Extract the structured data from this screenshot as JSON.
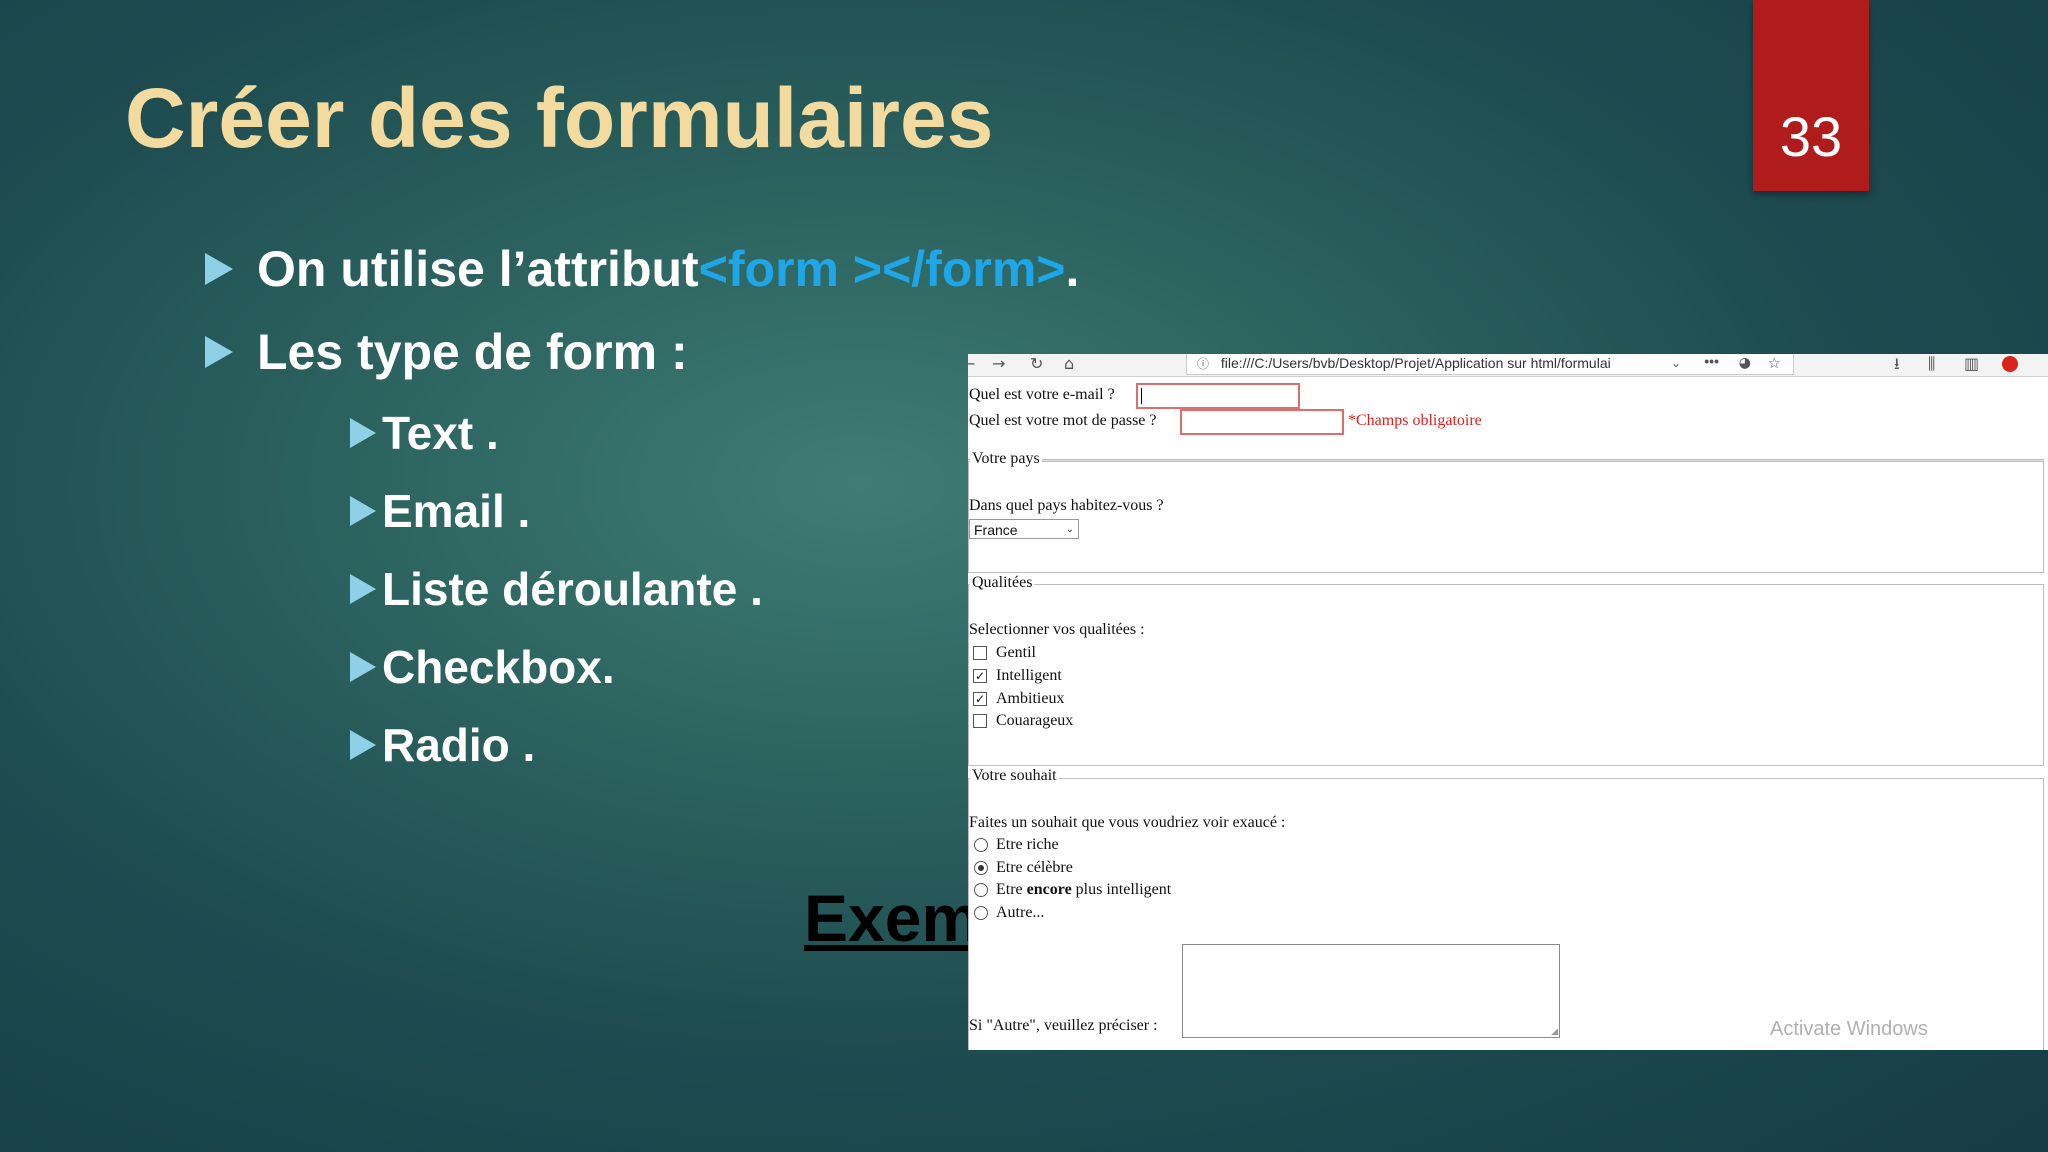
{
  "slide": {
    "title": "Créer des formulaires",
    "page_number": "33",
    "bullets": [
      {
        "text": "On utilise l’attribut ",
        "code": "<form ></form>",
        "suffix": " ."
      },
      {
        "text": "Les type de form :"
      }
    ],
    "sub_bullets": [
      "Text .",
      "Email .",
      "Liste déroulante .",
      "Checkbox.",
      "Radio ."
    ],
    "example_label": "Exem"
  },
  "browser": {
    "url": "file:///C:/Users/bvb/Desktop/Projet/Application sur html/formulai",
    "icons": [
      "back-icon",
      "forward-icon",
      "reload-icon",
      "home-icon",
      "info-icon",
      "chevron-down-icon",
      "more-icon",
      "pocket-icon",
      "star-icon",
      "download-icon",
      "library-icon",
      "sidebar-icon",
      "adblock-icon"
    ]
  },
  "form": {
    "email_label": "Quel est votre e-mail ?",
    "email_value": "",
    "password_label": "Quel est votre mot de passe ?",
    "password_value": "",
    "required_note": "*Champs obligatoire",
    "country": {
      "legend": "Votre pays",
      "question": "Dans quel pays habitez-vous ?",
      "selected": "France"
    },
    "qualities": {
      "legend": "Qualitées",
      "prompt": "Selectionner vos qualitées :",
      "options": [
        {
          "label": "Gentil",
          "checked": false
        },
        {
          "label": "Intelligent",
          "checked": true
        },
        {
          "label": "Ambitieux",
          "checked": true
        },
        {
          "label": "Couarageux",
          "checked": false
        }
      ]
    },
    "wish": {
      "legend": "Votre souhait",
      "prompt": "Faites un souhait que vous voudriez voir exaucé :",
      "options": [
        {
          "label": "Etre riche",
          "checked": false
        },
        {
          "label": "Etre célèbre",
          "checked": true
        },
        {
          "label_before": "Etre ",
          "label_bold": "encore",
          "label_after": " plus intelligent",
          "checked": false
        },
        {
          "label": "Autre...",
          "checked": false
        }
      ],
      "other_label": "Si \"Autre\", veuillez préciser :",
      "other_value": ""
    }
  },
  "watermark": "Activate Windows",
  "colors": {
    "title": "#f3dba0",
    "code": "#1ea6e8",
    "badge": "#b01c1c",
    "bullet_marker": "#8fd0e6",
    "required": "#e01e1e"
  }
}
